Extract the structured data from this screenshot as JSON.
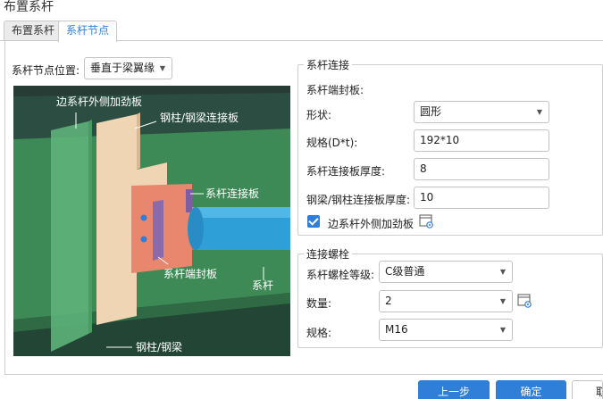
{
  "window": {
    "title": "布置系杆"
  },
  "tabs": [
    {
      "label": "布置系杆",
      "active": false
    },
    {
      "label": "系杆节点",
      "active": true
    }
  ],
  "node_position": {
    "label": "系杆节点位置:",
    "value": "垂直于梁翼缘"
  },
  "diagram_labels": {
    "side_stiffener": "边系杆外侧加劲板",
    "column_plate": "钢柱/钢梁连接板",
    "tie_plate": "系杆连接板",
    "end_plate": "系杆端封板",
    "tie_rod": "系杆",
    "column_beam": "钢柱/钢梁"
  },
  "tie_connection": {
    "title": "系杆连接",
    "end_plate_label": "系杆端封板:",
    "shape": {
      "label": "形状:",
      "value": "圆形"
    },
    "spec": {
      "label": "规格(D*t):",
      "value": "192*10"
    },
    "plate_thickness": {
      "label": "系杆连接板厚度:",
      "value": "8"
    },
    "column_plate_thickness": {
      "label": "钢梁/钢柱连接板厚度:",
      "value": "10"
    },
    "side_stiffener": {
      "label": "边系杆外侧加劲板",
      "checked": true
    }
  },
  "bolts": {
    "title": "连接螺栓",
    "grade": {
      "label": "系杆螺栓等级:",
      "value": "C级普通"
    },
    "count": {
      "label": "数量:",
      "value": "2"
    },
    "spec": {
      "label": "规格:",
      "value": "M16"
    }
  },
  "buttons": {
    "prev": "上一步",
    "ok": "确定",
    "cancel": "取"
  },
  "colors": {
    "accent": "#2f7fd8",
    "scene_background": "#263c35",
    "column": "#3e8a56",
    "plate": "#f0d5b5",
    "end_plate": "#e9876e",
    "tie_rod": "#2f9fd8"
  }
}
